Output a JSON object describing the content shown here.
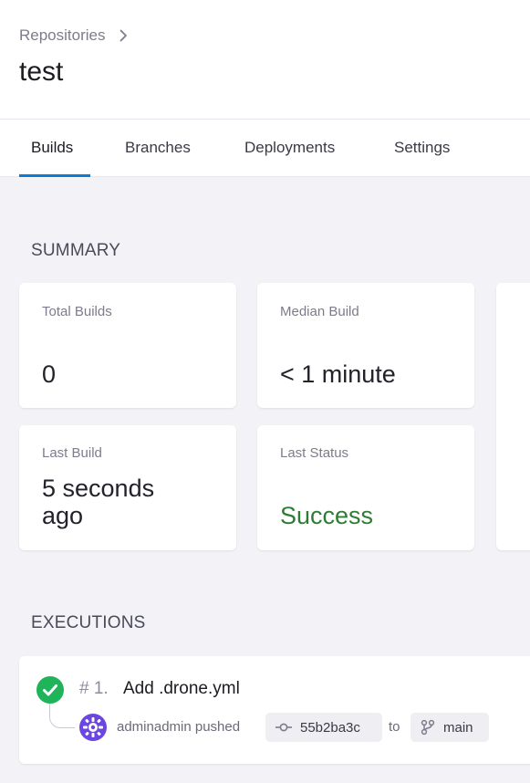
{
  "breadcrumb": {
    "label": "Repositories"
  },
  "repo": {
    "name": "test"
  },
  "tabs": [
    {
      "label": "Builds",
      "active": true
    },
    {
      "label": "Branches",
      "active": false
    },
    {
      "label": "Deployments",
      "active": false
    },
    {
      "label": "Settings",
      "active": false
    }
  ],
  "summary": {
    "title": "SUMMARY",
    "total_builds": {
      "label": "Total Builds",
      "value": "0"
    },
    "median_build": {
      "label": "Median Build",
      "value": "< 1 minute"
    },
    "last_build": {
      "label": "Last Build",
      "value_line1": "5 seconds",
      "value_line2": "ago"
    },
    "last_status": {
      "label": "Last Status",
      "value": "Success"
    }
  },
  "executions": {
    "title": "EXECUTIONS",
    "items": [
      {
        "number": "# 1.",
        "message": "Add .drone.yml",
        "author_text": "adminadmin pushed",
        "commit": "55b2ba3c",
        "to_text": "to",
        "branch": "main",
        "status": "success"
      }
    ]
  },
  "colors": {
    "accent": "#0a7bd6",
    "success": "#2d7d34",
    "success_icon": "#1fb35a",
    "avatar": "#6b46e0"
  }
}
